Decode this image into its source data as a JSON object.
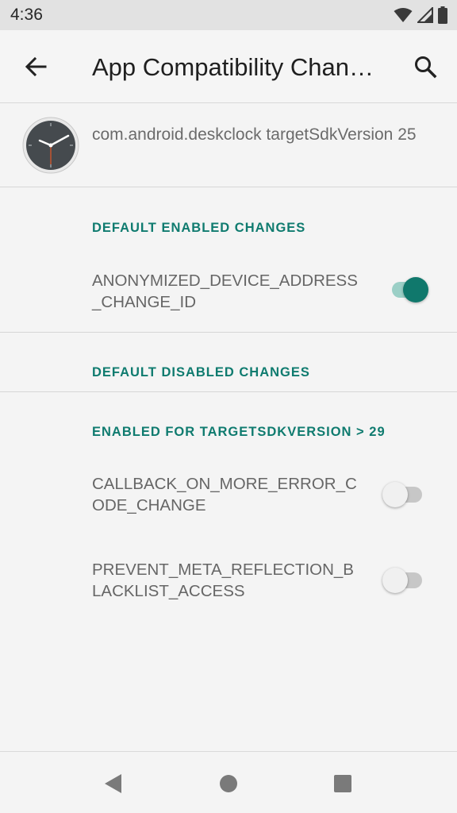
{
  "status_bar": {
    "time": "4:36",
    "icons": [
      "wifi-icon",
      "signal-icon",
      "battery-icon"
    ]
  },
  "app_bar": {
    "title": "App Compatibility Changes",
    "back_icon": "arrow-back-icon",
    "search_icon": "search-icon"
  },
  "app_header": {
    "icon": "clock-app-icon",
    "package_info": "com.android.deskclock targetSdkVersion 25"
  },
  "sections": [
    {
      "header": "DEFAULT ENABLED CHANGES",
      "items": [
        {
          "label": "ANONYMIZED_DEVICE_ADDRESS_CHANGE_ID",
          "enabled": true
        }
      ]
    },
    {
      "header": "DEFAULT DISABLED CHANGES",
      "items": []
    },
    {
      "header": "ENABLED FOR TARGETSDKVERSION > 29",
      "items": [
        {
          "label": "CALLBACK_ON_MORE_ERROR_CODE_CHANGE",
          "enabled": false
        },
        {
          "label": "PREVENT_META_REFLECTION_BLACKLIST_ACCESS",
          "enabled": false
        }
      ]
    }
  ],
  "nav_bar": {
    "buttons": [
      "back-triangle-icon",
      "home-circle-icon",
      "recents-square-icon"
    ]
  },
  "colors": {
    "accent": "#10786c",
    "accent_track": "#9bcfc6",
    "background": "#f4f4f4"
  }
}
